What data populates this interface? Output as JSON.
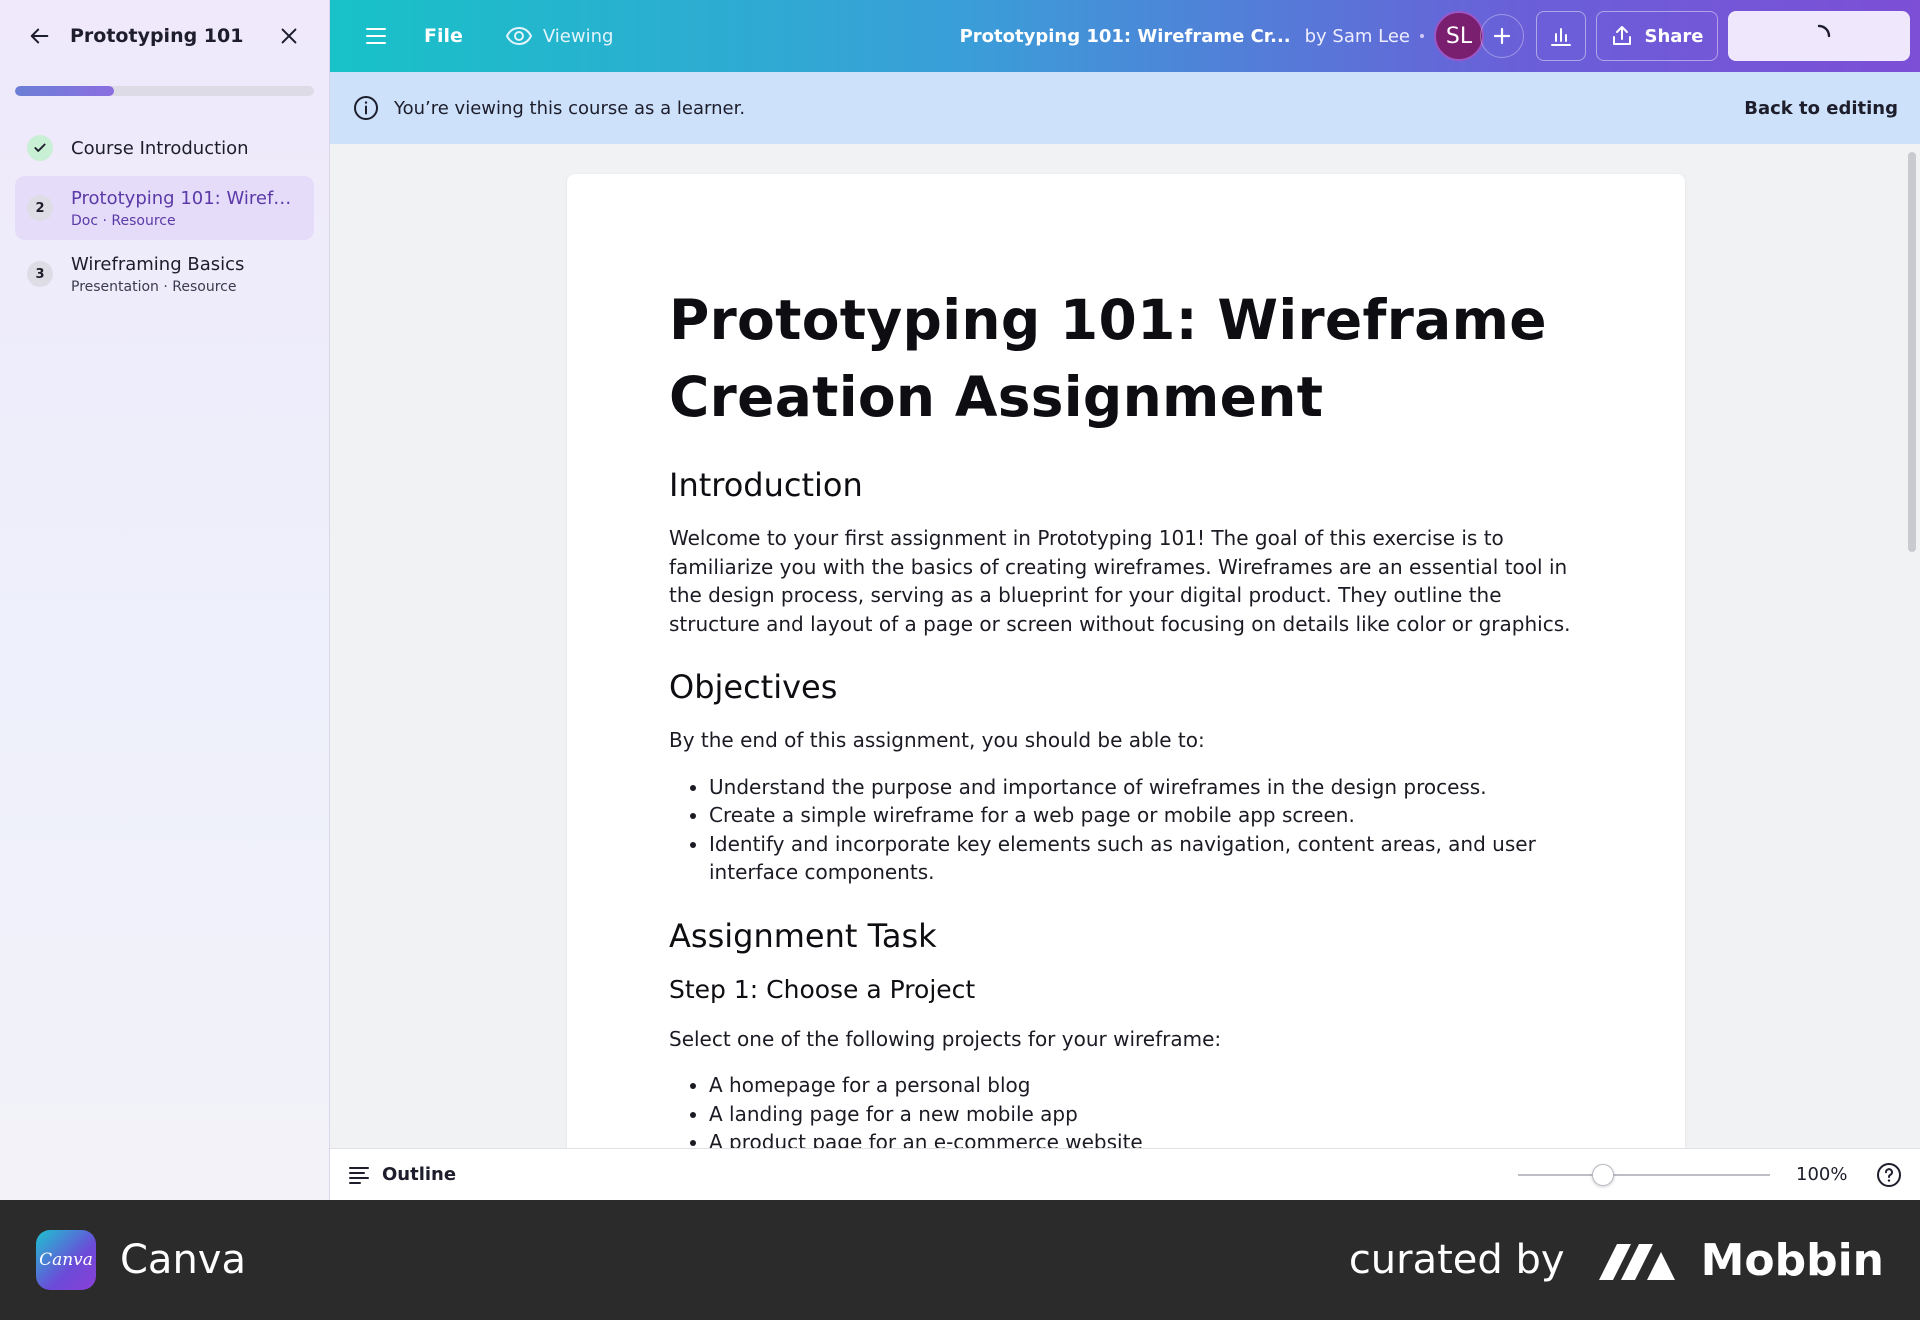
{
  "sidebar": {
    "title": "Prototyping 101",
    "progress": 0.33,
    "lessons": [
      {
        "badge": "✓",
        "name": "Course Introduction",
        "meta": "",
        "state": "done"
      },
      {
        "badge": "2",
        "name": "Prototyping 101: Wirefra...",
        "meta": "Doc · Resource",
        "state": "active"
      },
      {
        "badge": "3",
        "name": "Wireframing Basics",
        "meta": "Presentation · Resource",
        "state": "pending"
      }
    ]
  },
  "topbar": {
    "file_label": "File",
    "viewing_label": "Viewing",
    "doc_title": "Prototyping 101: Wireframe Cr...",
    "author": "by Sam Lee",
    "avatar_initials": "SL",
    "share_label": "Share"
  },
  "banner": {
    "message": "You’re viewing this course as a learner.",
    "back_to_editing": "Back to editing"
  },
  "doc": {
    "title": "Prototyping 101: Wireframe Creation Assignment",
    "intro_heading": "Introduction",
    "intro_text": "Welcome to your first assignment in Prototyping 101! The goal of this exercise is to familiarize you with the basics of creating wireframes. Wireframes are an essential tool in the design process, serving as a blueprint for your digital product. They outline the structure and layout of a page or screen without focusing on details like color or graphics.",
    "objectives_heading": "Objectives",
    "objectives_lead": "By the end of this assignment, you should be able to:",
    "objectives": [
      "Understand the purpose and importance of wireframes in the design process.",
      "Create a simple wireframe for a web page or mobile app screen.",
      "Identify and incorporate key elements such as navigation, content areas, and user interface components."
    ],
    "task_heading": "Assignment Task",
    "step1_heading": "Step 1: Choose a Project",
    "step1_lead": "Select one of the following projects for your wireframe:",
    "projects": [
      "A homepage for a personal blog",
      "A landing page for a new mobile app",
      "A product page for an e-commerce website"
    ]
  },
  "bottombar": {
    "outline_label": "Outline",
    "zoom_label": "100%",
    "zoom_level": 0.32
  },
  "footer": {
    "app_logo_text": "Canva",
    "app_name": "Canva",
    "curated_by": "curated by",
    "brand": "Mobbin"
  },
  "colors": {
    "topbar_gradient_start": "#18c2c8",
    "topbar_gradient_end": "#7c4fd6",
    "banner_bg": "#cde1fb",
    "active_lesson_bg": "#e4dcf8",
    "avatar_bg": "#7a1f6f"
  }
}
